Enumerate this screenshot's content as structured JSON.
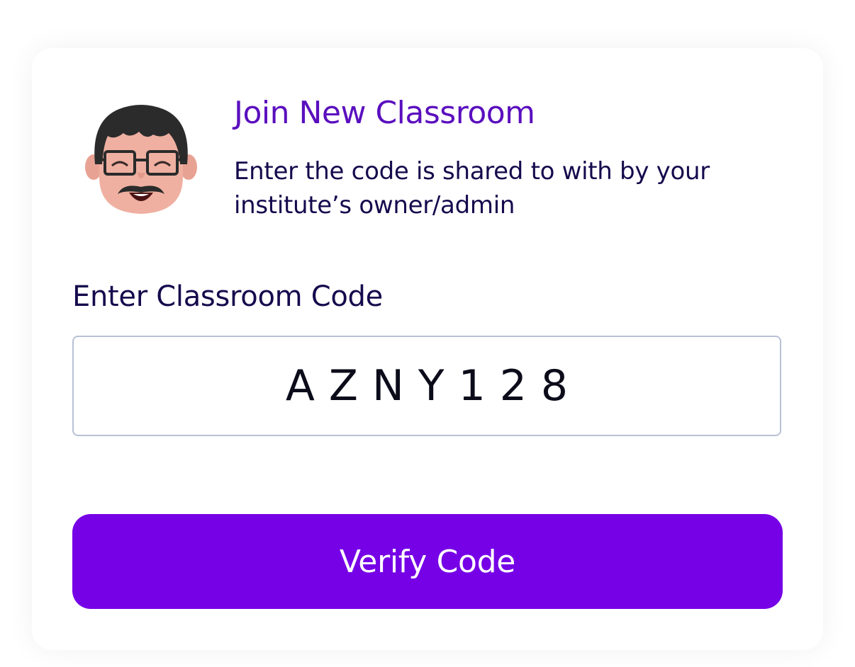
{
  "dialog": {
    "title": "Join New Classroom",
    "subtitle": "Enter the code is shared to with by your institute’s owner/admin",
    "avatar_icon": "teacher-avatar-icon"
  },
  "form": {
    "code_label": "Enter Classroom Code",
    "code_value": "AZNY128",
    "verify_label": "Verify Code"
  },
  "colors": {
    "title": "#5a0fbe",
    "text": "#160a4d",
    "primary_button": "#7600e6",
    "input_border": "#b7c1d6"
  }
}
